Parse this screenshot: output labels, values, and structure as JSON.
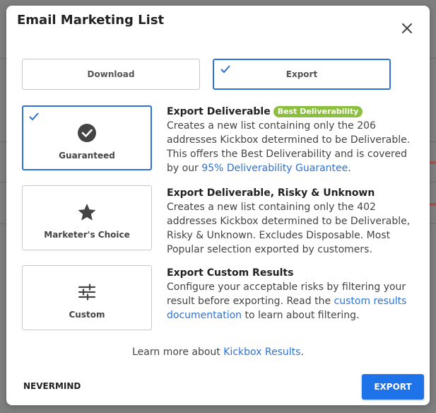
{
  "modal": {
    "title": "Email Marketing List",
    "close_icon": "close-icon"
  },
  "tabs": [
    {
      "label": "Download",
      "selected": false
    },
    {
      "label": "Export",
      "selected": true
    }
  ],
  "options": [
    {
      "label": "Guaranteed",
      "icon": "check-circle-icon",
      "selected": true,
      "title": "Export Deliverable",
      "badge": "Best Deliverability",
      "desc_pre": "Creates a new list containing only the 206 addresses Kickbox determined to be Deliverable. This offers the Best Deliverability and is covered by our ",
      "link": "95% Deliverability Guarantee",
      "desc_post": "."
    },
    {
      "label": "Marketer's Choice",
      "icon": "star-icon",
      "selected": false,
      "title": "Export Deliverable, Risky & Unknown",
      "desc": "Creates a new list containing only the 402 addresses Kickbox determined to be Deliverable, Risky & Unknown. Excludes Disposable. Most Popular selection exported by customers."
    },
    {
      "label": "Custom",
      "icon": "sliders-icon",
      "selected": false,
      "title": "Export Custom Results",
      "desc_pre": "Configure your acceptable risks by filtering your result before exporting. Read the ",
      "link": "custom results documentation",
      "desc_post": " to learn about filtering."
    }
  ],
  "learn_more": {
    "prefix": "Learn more about ",
    "link": "Kickbox Results",
    "suffix": "."
  },
  "footer": {
    "nevermind_label": "NEVERMIND",
    "export_label": "EXPORT"
  },
  "colors": {
    "accent": "#2e72d2",
    "export_button": "#1f73e8",
    "badge": "#8cbf3f"
  }
}
